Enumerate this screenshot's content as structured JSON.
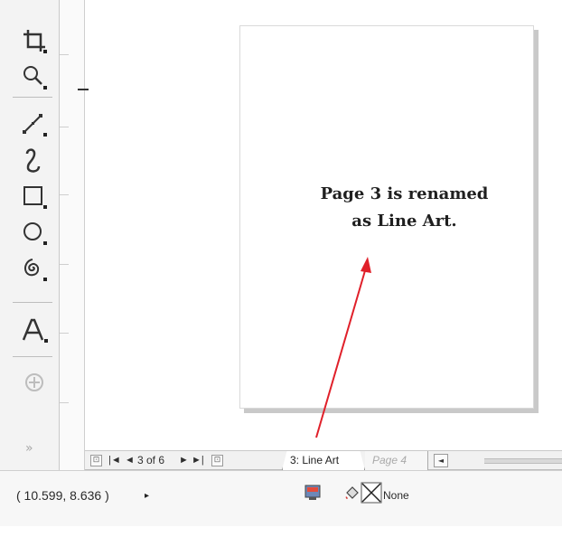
{
  "toolbox": {
    "tools": [
      {
        "name": "crop-tool",
        "icon": "crop-icon"
      },
      {
        "name": "zoom-tool",
        "icon": "zoom-icon"
      },
      {
        "name": "freehand-tool",
        "icon": "freehand-icon"
      },
      {
        "name": "artistic-media-tool",
        "icon": "artistic-media-icon"
      },
      {
        "name": "rectangle-tool",
        "icon": "rectangle-icon"
      },
      {
        "name": "ellipse-tool",
        "icon": "ellipse-icon"
      },
      {
        "name": "spiral-tool",
        "icon": "spiral-icon"
      },
      {
        "name": "text-tool",
        "icon": "text-icon"
      },
      {
        "name": "add-tool",
        "icon": "plus-circle-icon"
      }
    ],
    "more_label": "»"
  },
  "annotation": {
    "line1": "Page 3 is renamed",
    "line2": "as Line Art.",
    "color": "#e0202a"
  },
  "navigator": {
    "first": "|◄",
    "prev": "◄",
    "position": "3 of 6",
    "next": "►",
    "last": "►|",
    "active_tab": "3: Line Art",
    "next_tab": "Page 4",
    "scroll_left": "◄"
  },
  "status": {
    "coordinates": "( 10.599, 8.636 )",
    "coords_arrow": "▸",
    "fill_label": "None"
  }
}
